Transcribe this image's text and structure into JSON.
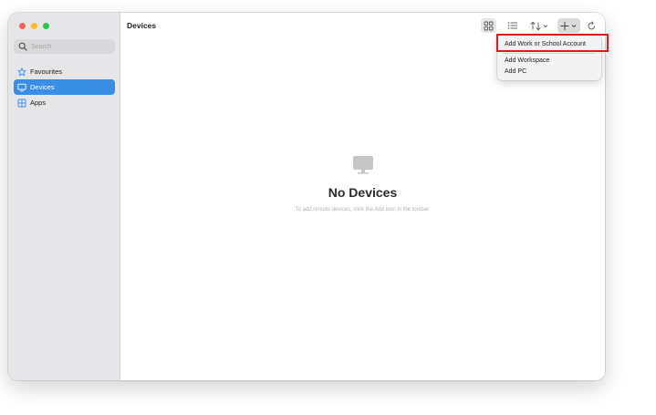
{
  "sidebar": {
    "search_placeholder": "Search",
    "items": [
      {
        "label": "Favourites",
        "icon": "star-icon",
        "active": false
      },
      {
        "label": "Devices",
        "icon": "monitor-icon",
        "active": true
      },
      {
        "label": "Apps",
        "icon": "grid-icon",
        "active": false
      }
    ]
  },
  "header": {
    "title": "Devices"
  },
  "toolbar": {
    "buttons": [
      "grid-view-icon",
      "list-view-icon",
      "sort-icon",
      "add-icon",
      "refresh-icon"
    ]
  },
  "empty_state": {
    "title": "No Devices",
    "message": "To add remote devices, click the Add icon in the toolbar."
  },
  "add_menu": {
    "items": [
      "Add Work or School Account",
      "Add Workspace",
      "Add PC"
    ]
  },
  "colors": {
    "accent": "#3a8ee6",
    "highlight": "#e3181b",
    "traffic_red": "#fe5f57",
    "traffic_yellow": "#febc2e",
    "traffic_green": "#28c840"
  }
}
